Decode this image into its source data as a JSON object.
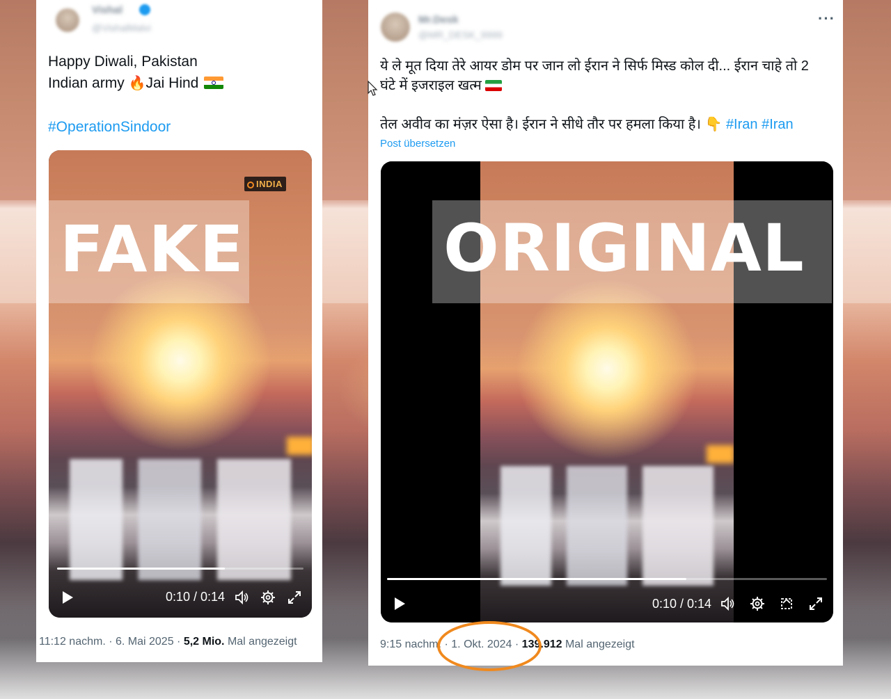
{
  "left_post": {
    "text_line1": "Happy Diwali,  Pakistan",
    "text_line2_pre": "Indian army",
    "text_line2_post": "Jai Hind",
    "hashtag": "#OperationSindoor",
    "video": {
      "watermark": "INDIA",
      "time": "0:10 / 0:14",
      "progress": 0.68
    },
    "stamp": "FAKE",
    "footer_time": "11:12 nachm. · 6. Mai 2025 · ",
    "footer_views": "5,2 Mio.",
    "footer_suffix": " Mal angezeigt"
  },
  "right_post": {
    "more": "···",
    "text_line1": "ये ले मूत दिया तेरे आयर डोम पर जान लो ईरान ने सिर्फ मिस्ड कोल दी... ईरान चाहे तो 2",
    "text_line2": "घंटे में इजराइल खत्म",
    "text_line3": "तेल अवीव का मंज़र ऐसा है। ईरान ने सीधे तौर पर हमला किया है।",
    "hashtags": "#Iran #Iran",
    "translate": "Post übersetzen",
    "video": {
      "time": "0:10 / 0:14",
      "progress": 0.68
    },
    "stamp": "ORIGINAL",
    "footer_time": "9:15 nachm. · ",
    "footer_date": "1. Okt. 2024",
    "footer_mid": " · ",
    "footer_views": "139.912",
    "footer_suffix": " Mal angezeigt"
  },
  "colors": {
    "link": "#1d9bf0",
    "circle_mark": "#f0891e",
    "stamp_text": "#ffffff"
  }
}
